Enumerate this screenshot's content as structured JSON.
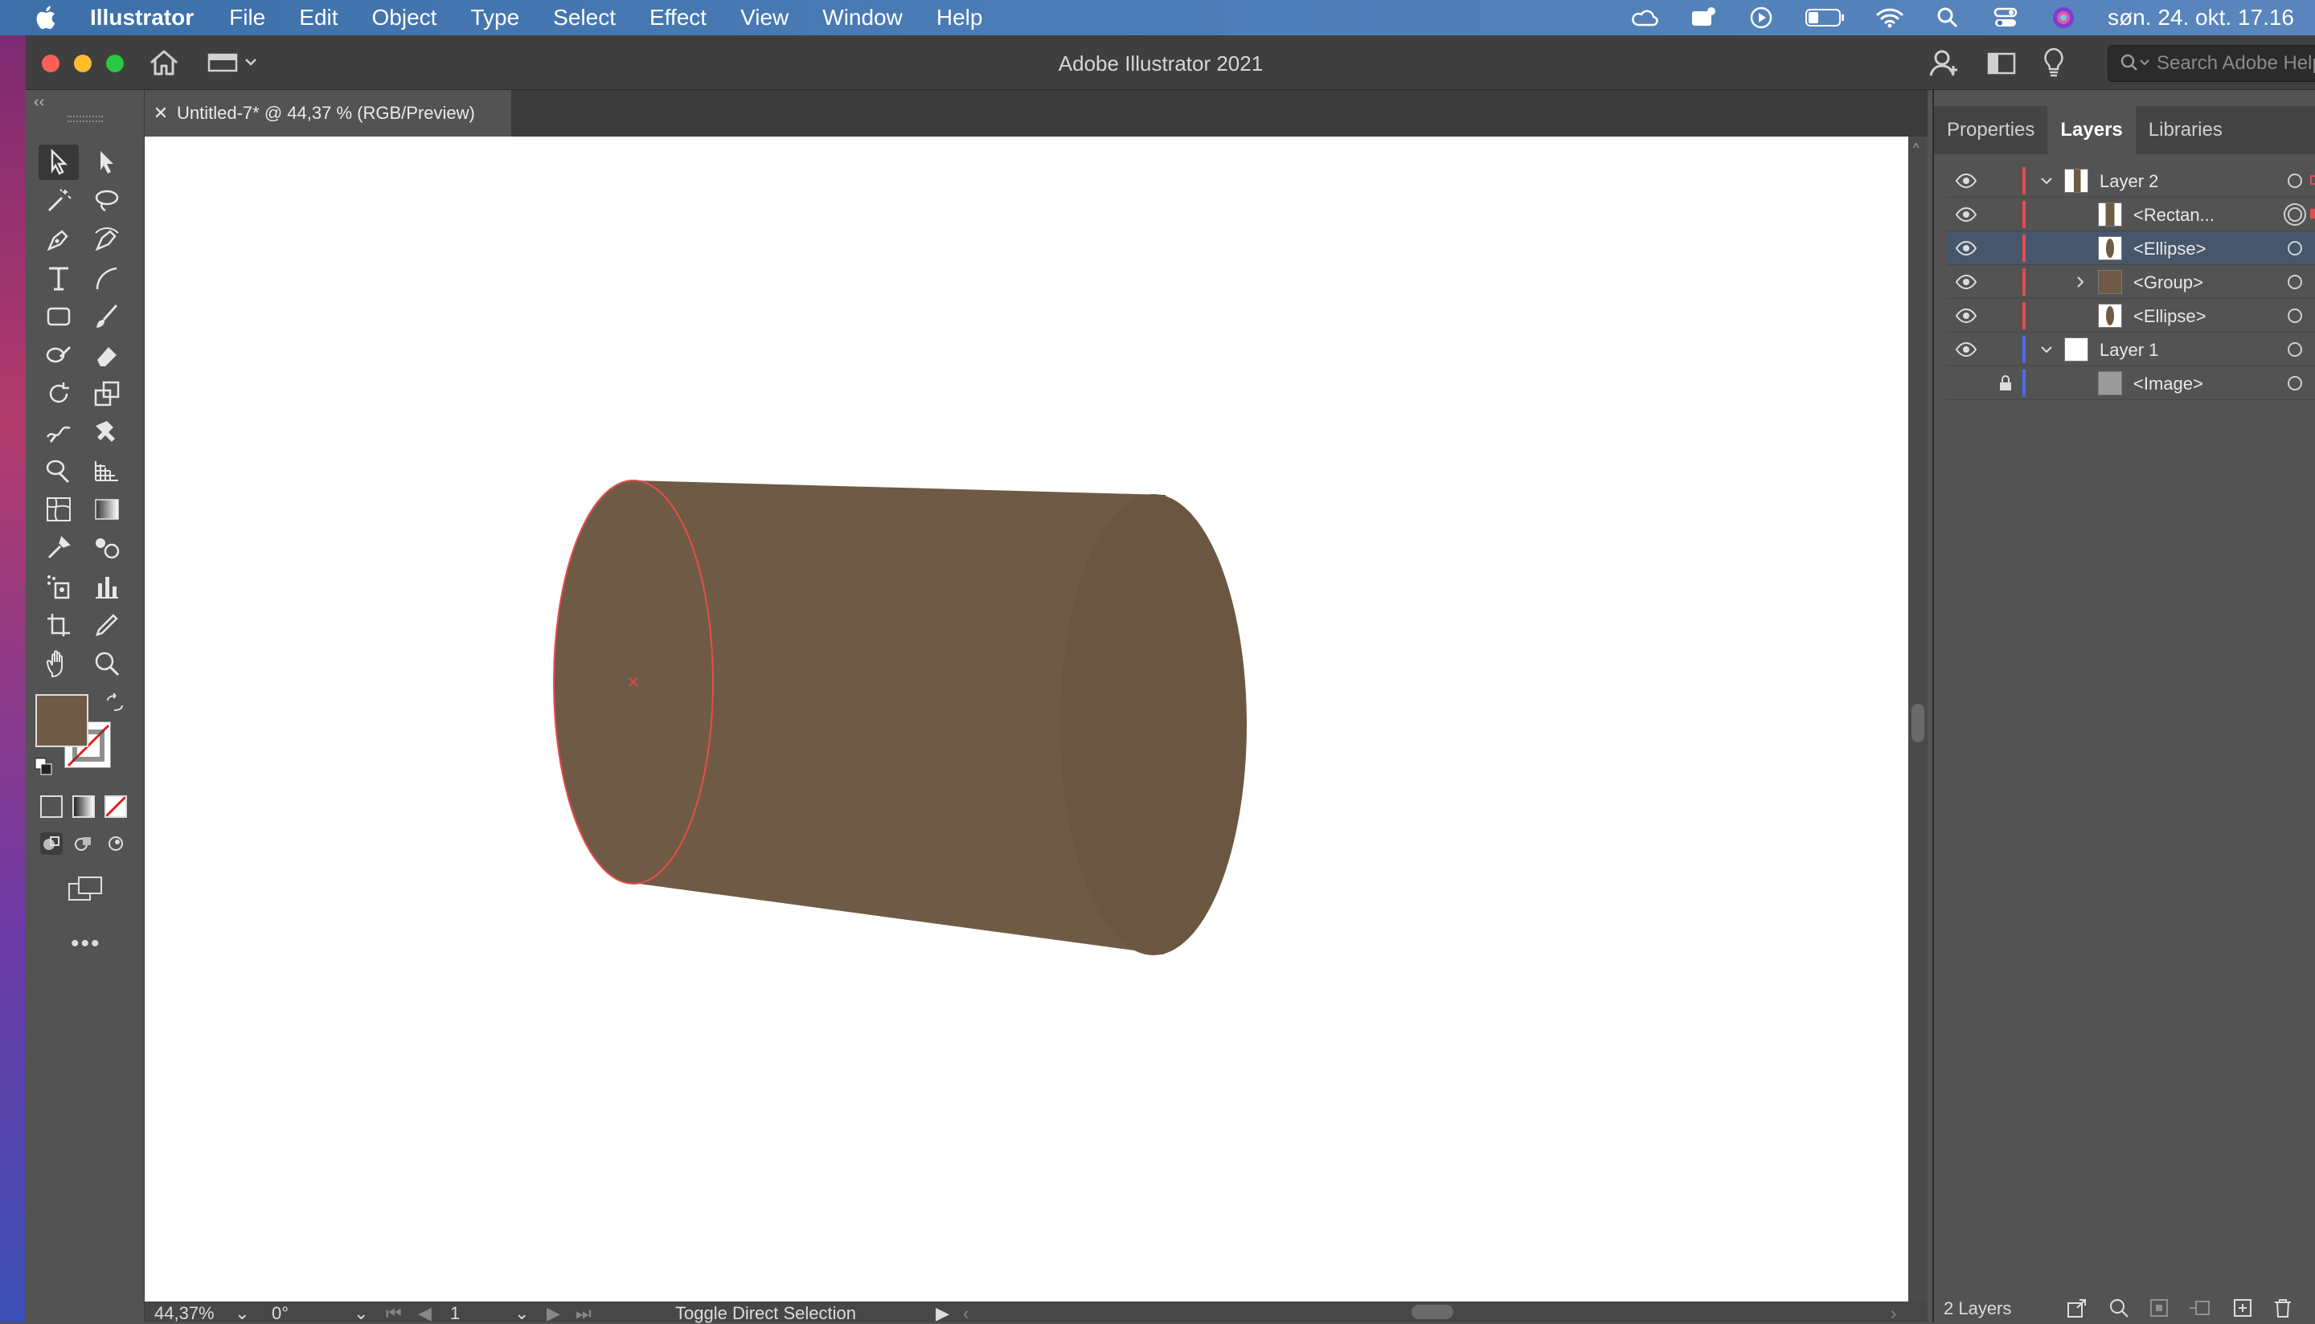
{
  "menubar": {
    "app_name": "Illustrator",
    "items": [
      "File",
      "Edit",
      "Object",
      "Type",
      "Select",
      "Effect",
      "View",
      "Window",
      "Help"
    ],
    "clock": "søn. 24. okt. 17.16",
    "status_icons": [
      "creative-cloud-icon",
      "notification-icon",
      "play-icon",
      "battery-icon",
      "wifi-icon",
      "spotlight-icon",
      "control-center-icon",
      "siri-icon"
    ]
  },
  "window": {
    "title": "Adobe Illustrator 2021",
    "search_placeholder": "Search Adobe Help"
  },
  "document": {
    "tab_label": "Untitled-7* @ 44,37 % (RGB/Preview)",
    "fill_color": "#6f5b45",
    "selection_color": "#e84b4b"
  },
  "status": {
    "zoom": "44,37%",
    "rotation": "0°",
    "artboard": "1",
    "tool_hint": "Toggle Direct Selection"
  },
  "panel": {
    "tabs": [
      "Properties",
      "Layers",
      "Libraries"
    ],
    "active_tab": "Layers",
    "layers": [
      {
        "name": "Layer 2",
        "level": 0,
        "expanded": true,
        "color": "#e84b4b"
      },
      {
        "name": "<Rectan...",
        "level": 1,
        "color": "#e84b4b"
      },
      {
        "name": "<Ellipse>",
        "level": 1,
        "color": "#e84b4b",
        "selected": true
      },
      {
        "name": "<Group>",
        "level": 1,
        "color": "#e84b4b",
        "collapsed": true
      },
      {
        "name": "<Ellipse>",
        "level": 1,
        "color": "#e84b4b"
      },
      {
        "name": "Layer 1",
        "level": 0,
        "expanded": true,
        "color": "#4a6bf0"
      },
      {
        "name": "<Image>",
        "level": 1,
        "color": "#4a6bf0",
        "locked": true
      }
    ],
    "footer_count": "2 Layers"
  }
}
